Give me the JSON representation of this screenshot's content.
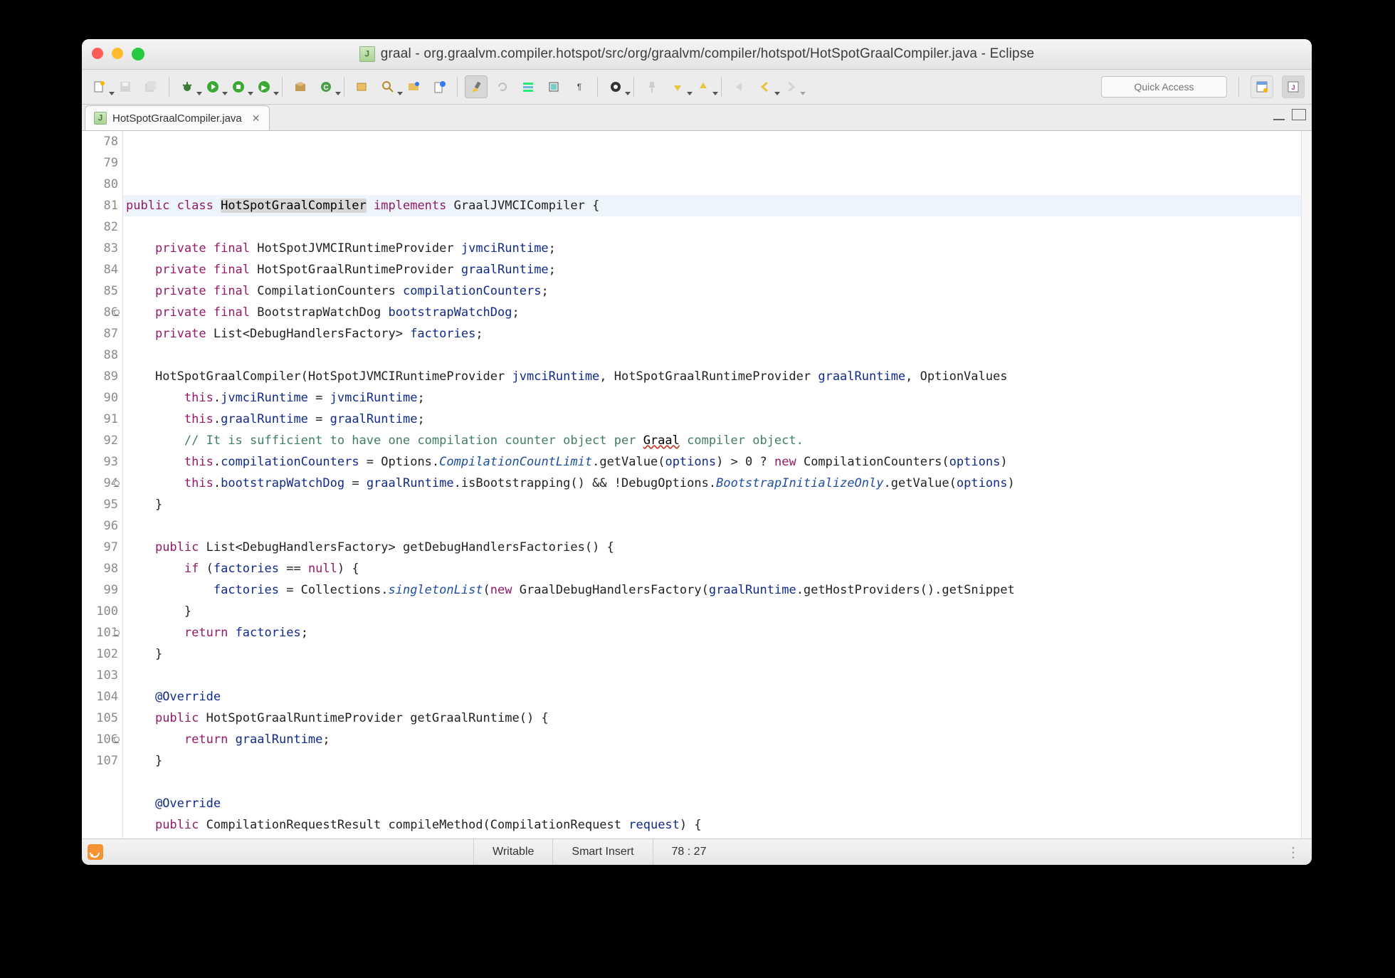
{
  "window": {
    "title": "graal - org.graalvm.compiler.hotspot/src/org/graalvm/compiler/hotspot/HotSpotGraalCompiler.java - Eclipse"
  },
  "toolbar": {
    "quick_access_placeholder": "Quick Access"
  },
  "tabs": {
    "active": "HotSpotGraalCompiler.java"
  },
  "editor": {
    "first_line_number": 78,
    "lines": [
      {
        "n": 78,
        "hl": true,
        "fold": false,
        "warn": false,
        "tokens": [
          [
            "kw",
            "public "
          ],
          [
            "kw",
            "class "
          ],
          [
            "sel",
            "HotSpotGraalCompiler"
          ],
          [
            "op",
            " "
          ],
          [
            "kw",
            "implements"
          ],
          [
            "op",
            " "
          ],
          [
            "typ",
            "GraalJVMCICompiler"
          ],
          [
            "op",
            " {"
          ]
        ]
      },
      {
        "n": 79,
        "tokens": []
      },
      {
        "n": 80,
        "tokens": [
          [
            "op",
            "    "
          ],
          [
            "kw",
            "private "
          ],
          [
            "kw",
            "final "
          ],
          [
            "typ",
            "HotSpotJVMCIRuntimeProvider "
          ],
          [
            "fld",
            "jvmciRuntime"
          ],
          [
            "op",
            ";"
          ]
        ]
      },
      {
        "n": 81,
        "tokens": [
          [
            "op",
            "    "
          ],
          [
            "kw",
            "private "
          ],
          [
            "kw",
            "final "
          ],
          [
            "typ",
            "HotSpotGraalRuntimeProvider "
          ],
          [
            "fld",
            "graalRuntime"
          ],
          [
            "op",
            ";"
          ]
        ]
      },
      {
        "n": 82,
        "tokens": [
          [
            "op",
            "    "
          ],
          [
            "kw",
            "private "
          ],
          [
            "kw",
            "final "
          ],
          [
            "typ",
            "CompilationCounters "
          ],
          [
            "fld",
            "compilationCounters"
          ],
          [
            "op",
            ";"
          ]
        ]
      },
      {
        "n": 83,
        "tokens": [
          [
            "op",
            "    "
          ],
          [
            "kw",
            "private "
          ],
          [
            "kw",
            "final "
          ],
          [
            "typ",
            "BootstrapWatchDog "
          ],
          [
            "fld",
            "bootstrapWatchDog"
          ],
          [
            "op",
            ";"
          ]
        ]
      },
      {
        "n": 84,
        "tokens": [
          [
            "op",
            "    "
          ],
          [
            "kw",
            "private "
          ],
          [
            "typ",
            "List<DebugHandlersFactory> "
          ],
          [
            "fld",
            "factories"
          ],
          [
            "op",
            ";"
          ]
        ]
      },
      {
        "n": 85,
        "tokens": []
      },
      {
        "n": 86,
        "fold": true,
        "tokens": [
          [
            "op",
            "    "
          ],
          [
            "typ",
            "HotSpotGraalCompiler"
          ],
          [
            "op",
            "(HotSpotJVMCIRuntimeProvider "
          ],
          [
            "fld",
            "jvmciRuntime"
          ],
          [
            "op",
            ", HotSpotGraalRuntimeProvider "
          ],
          [
            "fld",
            "graalRuntime"
          ],
          [
            "op",
            ", OptionValues"
          ]
        ]
      },
      {
        "n": 87,
        "tokens": [
          [
            "op",
            "        "
          ],
          [
            "kw",
            "this"
          ],
          [
            "op",
            "."
          ],
          [
            "fld",
            "jvmciRuntime"
          ],
          [
            "op",
            " = "
          ],
          [
            "fld",
            "jvmciRuntime"
          ],
          [
            "op",
            ";"
          ]
        ]
      },
      {
        "n": 88,
        "tokens": [
          [
            "op",
            "        "
          ],
          [
            "kw",
            "this"
          ],
          [
            "op",
            "."
          ],
          [
            "fld",
            "graalRuntime"
          ],
          [
            "op",
            " = "
          ],
          [
            "fld",
            "graalRuntime"
          ],
          [
            "op",
            ";"
          ]
        ]
      },
      {
        "n": 89,
        "tokens": [
          [
            "op",
            "        "
          ],
          [
            "cmt",
            "// It is sufficient to have one compilation counter object per "
          ],
          [
            "err",
            "Graal"
          ],
          [
            "cmt",
            " compiler object."
          ]
        ]
      },
      {
        "n": 90,
        "tokens": [
          [
            "op",
            "        "
          ],
          [
            "kw",
            "this"
          ],
          [
            "op",
            "."
          ],
          [
            "fld",
            "compilationCounters"
          ],
          [
            "op",
            " = Options."
          ],
          [
            "it",
            "CompilationCountLimit"
          ],
          [
            "op",
            ".getValue("
          ],
          [
            "fld",
            "options"
          ],
          [
            "op",
            ") > 0 ? "
          ],
          [
            "kw",
            "new"
          ],
          [
            "op",
            " CompilationCounters("
          ],
          [
            "fld",
            "options"
          ],
          [
            "op",
            ")"
          ]
        ]
      },
      {
        "n": 91,
        "tokens": [
          [
            "op",
            "        "
          ],
          [
            "kw",
            "this"
          ],
          [
            "op",
            "."
          ],
          [
            "fld",
            "bootstrapWatchDog"
          ],
          [
            "op",
            " = "
          ],
          [
            "fld",
            "graalRuntime"
          ],
          [
            "op",
            ".isBootstrapping() && !DebugOptions."
          ],
          [
            "it",
            "BootstrapInitializeOnly"
          ],
          [
            "op",
            ".getValue("
          ],
          [
            "fld",
            "options"
          ],
          [
            "op",
            ")"
          ]
        ]
      },
      {
        "n": 92,
        "tokens": [
          [
            "op",
            "    }"
          ]
        ]
      },
      {
        "n": 93,
        "tokens": []
      },
      {
        "n": 94,
        "fold": true,
        "tokens": [
          [
            "op",
            "    "
          ],
          [
            "kw",
            "public "
          ],
          [
            "typ",
            "List<DebugHandlersFactory> "
          ],
          [
            "mth",
            "getDebugHandlersFactories"
          ],
          [
            "op",
            "() {"
          ]
        ]
      },
      {
        "n": 95,
        "tokens": [
          [
            "op",
            "        "
          ],
          [
            "kw",
            "if"
          ],
          [
            "op",
            " ("
          ],
          [
            "fld",
            "factories"
          ],
          [
            "op",
            " == "
          ],
          [
            "kw",
            "null"
          ],
          [
            "op",
            ") {"
          ]
        ]
      },
      {
        "n": 96,
        "tokens": [
          [
            "op",
            "            "
          ],
          [
            "fld",
            "factories"
          ],
          [
            "op",
            " = Collections."
          ],
          [
            "it",
            "singletonList"
          ],
          [
            "op",
            "("
          ],
          [
            "kw",
            "new"
          ],
          [
            "op",
            " GraalDebugHandlersFactory("
          ],
          [
            "fld",
            "graalRuntime"
          ],
          [
            "op",
            ".getHostProviders().getSnippet"
          ]
        ]
      },
      {
        "n": 97,
        "tokens": [
          [
            "op",
            "        }"
          ]
        ]
      },
      {
        "n": 98,
        "tokens": [
          [
            "op",
            "        "
          ],
          [
            "kw",
            "return"
          ],
          [
            "op",
            " "
          ],
          [
            "fld",
            "factories"
          ],
          [
            "op",
            ";"
          ]
        ]
      },
      {
        "n": 99,
        "tokens": [
          [
            "op",
            "    }"
          ]
        ]
      },
      {
        "n": 100,
        "tokens": []
      },
      {
        "n": 101,
        "fold": true,
        "tokens": [
          [
            "op",
            "    "
          ],
          [
            "fld",
            "@Override"
          ]
        ]
      },
      {
        "n": 102,
        "warn": true,
        "tokens": [
          [
            "op",
            "    "
          ],
          [
            "kw",
            "public "
          ],
          [
            "typ",
            "HotSpotGraalRuntimeProvider "
          ],
          [
            "mth",
            "getGraalRuntime"
          ],
          [
            "op",
            "() {"
          ]
        ]
      },
      {
        "n": 103,
        "tokens": [
          [
            "op",
            "        "
          ],
          [
            "kw",
            "return"
          ],
          [
            "op",
            " "
          ],
          [
            "fld",
            "graalRuntime"
          ],
          [
            "op",
            ";"
          ]
        ]
      },
      {
        "n": 104,
        "tokens": [
          [
            "op",
            "    }"
          ]
        ]
      },
      {
        "n": 105,
        "tokens": []
      },
      {
        "n": 106,
        "fold": true,
        "tokens": [
          [
            "op",
            "    "
          ],
          [
            "fld",
            "@Override"
          ]
        ]
      },
      {
        "n": 107,
        "warn": true,
        "tokens": [
          [
            "op",
            "    "
          ],
          [
            "kw",
            "public "
          ],
          [
            "typ",
            "CompilationRequestResult "
          ],
          [
            "mth",
            "compileMethod"
          ],
          [
            "op",
            "(CompilationRequest "
          ],
          [
            "fld",
            "request"
          ],
          [
            "op",
            ") {"
          ]
        ]
      }
    ]
  },
  "status": {
    "writable": "Writable",
    "insert_mode": "Smart Insert",
    "cursor": "78 : 27"
  }
}
